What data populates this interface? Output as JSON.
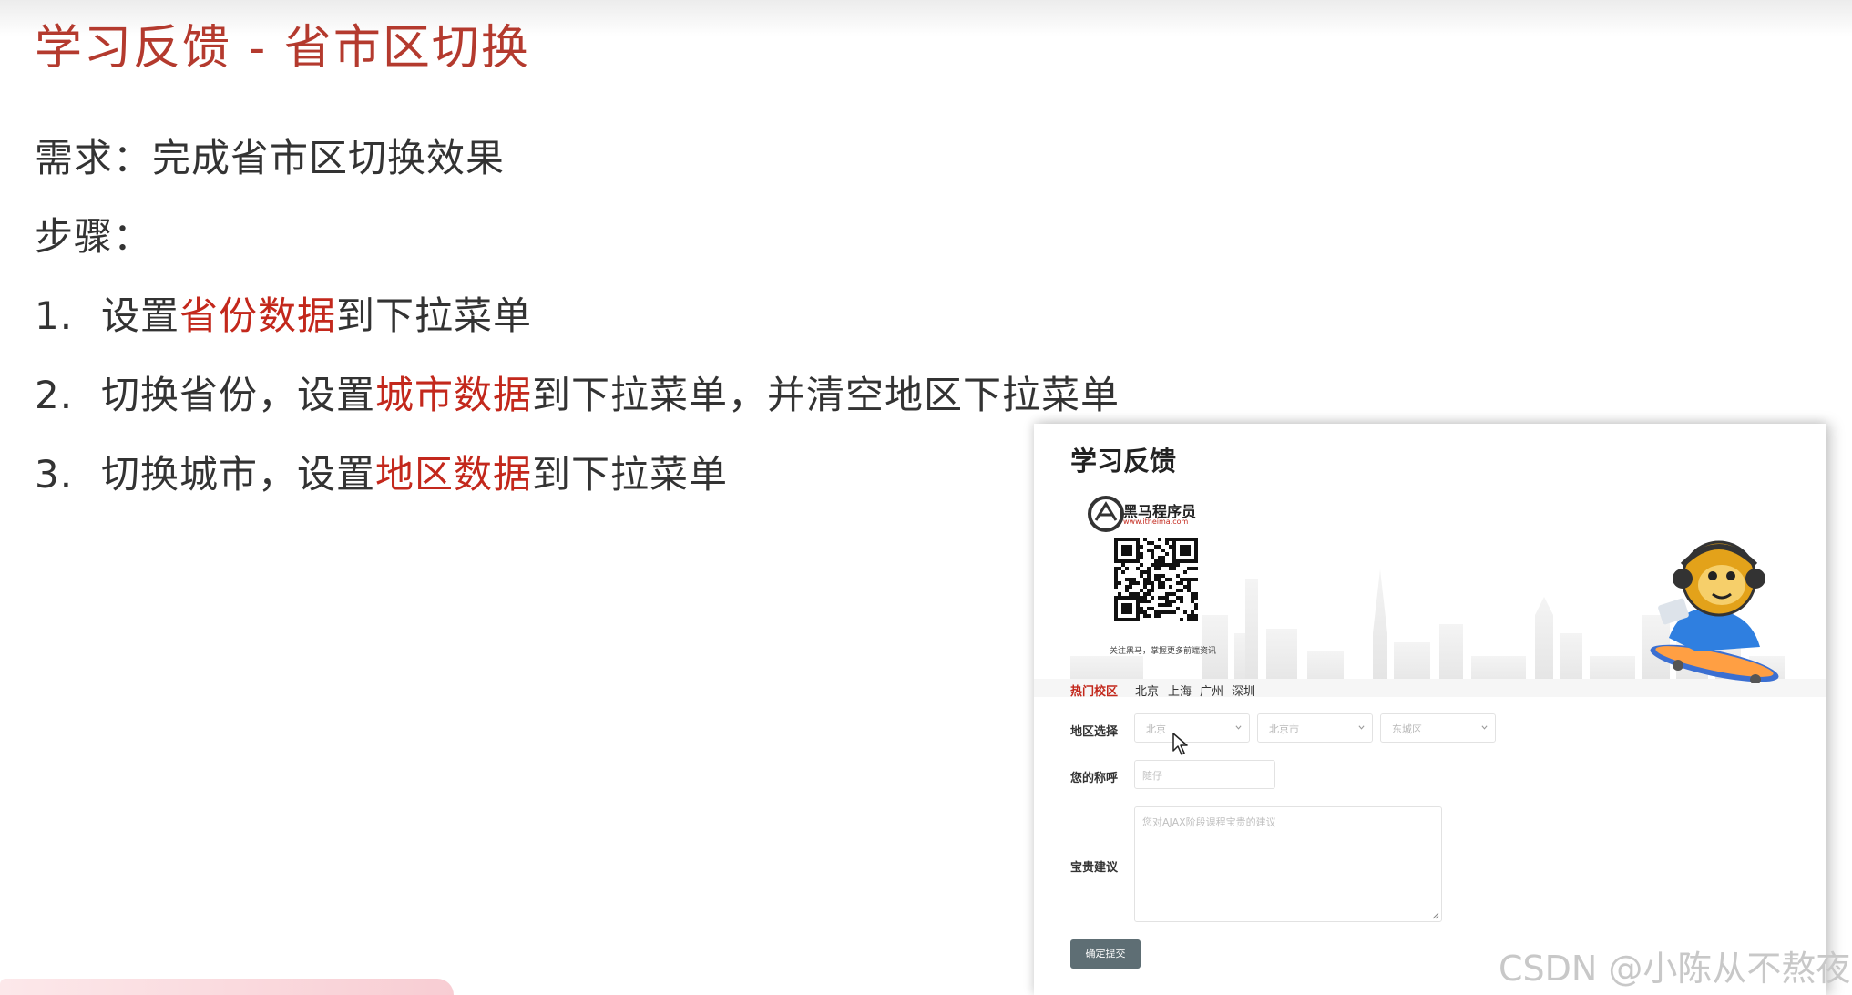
{
  "slide": {
    "title": "学习反馈 - 省市区切换",
    "requirement": "需求：完成省市区切换效果",
    "steps_label": "步骤：",
    "steps": [
      {
        "num": "1.",
        "pre": "设置",
        "hl": "省份数据",
        "post": "到下拉菜单"
      },
      {
        "num": "2.",
        "pre": "切换省份，设置",
        "hl": "城市数据",
        "post": "到下拉菜单，并清空地区下拉菜单"
      },
      {
        "num": "3.",
        "pre": "切换城市，设置",
        "hl": "地区数据",
        "post": "到下拉菜单"
      }
    ],
    "accent_color": "#c3281c"
  },
  "feedback_page": {
    "title": "学习反馈",
    "brand_name": "黑马程序员",
    "brand_url": "www.itheima.com",
    "qr_caption": "关注黑马，掌握更多前端资讯",
    "hot_campus_label": "热门校区",
    "campuses": [
      "北京",
      "上海",
      "广州",
      "深圳"
    ],
    "region_label": "地区选择",
    "province_value": "北京",
    "city_value": "北京市",
    "district_value": "东城区",
    "nickname_label": "您的称呼",
    "nickname_placeholder": "随仔",
    "advice_label": "宝贵建议",
    "advice_placeholder": "您对AJAX阶段课程宝贵的建议",
    "submit_label": "确定提交",
    "button_color": "#5e6e74"
  },
  "watermark": "CSDN @小陈从不熬夜",
  "icons": [
    "itheima-logo-icon",
    "qr-code",
    "mascot-illustration",
    "chevron-down-icon",
    "mouse-cursor-icon",
    "resize-grip-icon"
  ]
}
